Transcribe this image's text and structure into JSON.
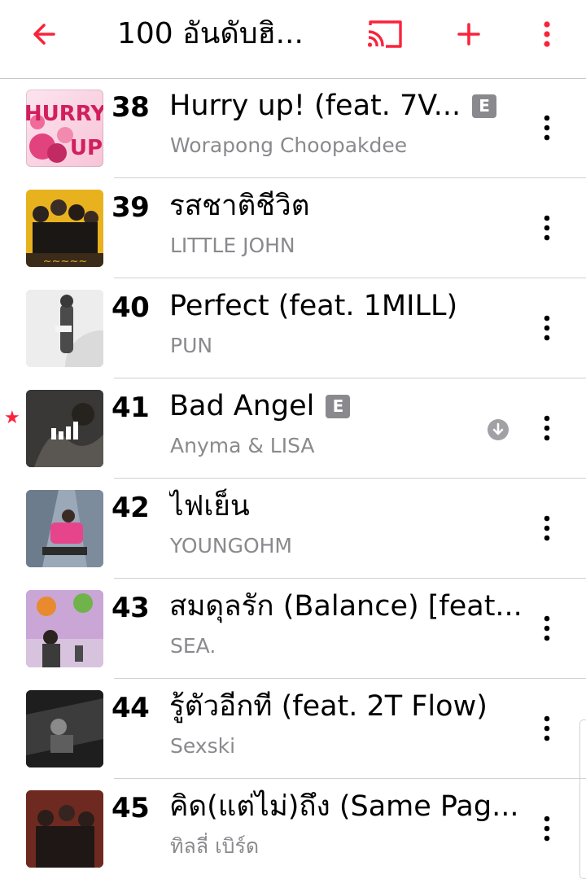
{
  "nav": {
    "title": "100 อันดับฮิ...",
    "back_icon": "chevron-left-icon",
    "cast_icon": "cast-icon",
    "add_icon": "plus-icon",
    "more_icon": "vertical-ellipsis-icon"
  },
  "colors": {
    "accent": "#fa233b",
    "secondary_text": "#8a8a8e",
    "divider": "#d1d1d6"
  },
  "songs": [
    {
      "rank": "38",
      "title": "Hurry up! (feat. 7V...",
      "artist": "Worapong Choopakdee",
      "explicit": "E"
    },
    {
      "rank": "39",
      "title": "รสชาติชีวิต",
      "artist": "LITTLE JOHN"
    },
    {
      "rank": "40",
      "title": "Perfect (feat. 1MILL)",
      "artist": "PUN"
    },
    {
      "rank": "41",
      "title": "Bad Angel",
      "artist": "Anyma & LISA",
      "explicit": "E",
      "now_playing": true,
      "favorited": true,
      "downloaded": true
    },
    {
      "rank": "42",
      "title": "ไฟเย็น",
      "artist": "YOUNGOHM"
    },
    {
      "rank": "43",
      "title": "สมดุลรัก (Balance) [feat...",
      "artist": "SEA."
    },
    {
      "rank": "44",
      "title": "รู้ตัวอีกที (feat. 2T Flow)",
      "artist": "Sexski"
    },
    {
      "rank": "45",
      "title": "คิด(แต่ไม่)ถึง (Same Pag...",
      "artist": "ทิลลี่ เบิร์ด"
    }
  ]
}
